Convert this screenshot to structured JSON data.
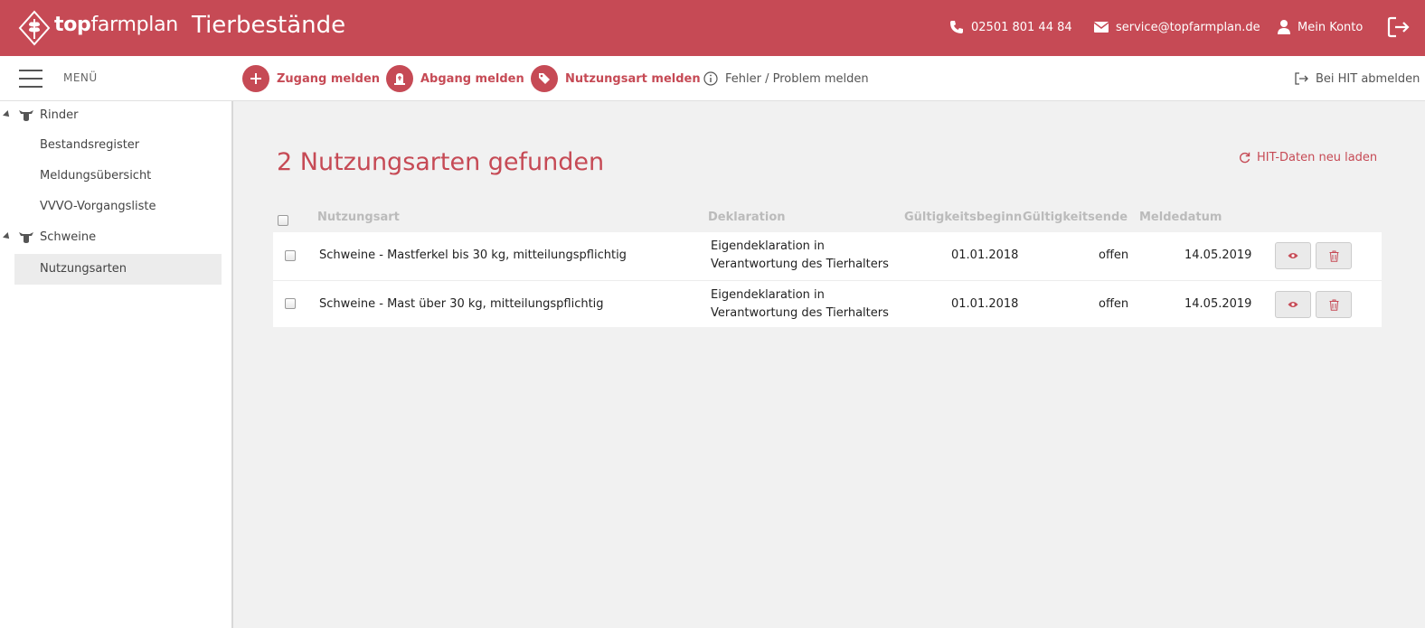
{
  "header": {
    "brand_bold": "top",
    "brand_rest": "farmplan",
    "title": "Tierbestände",
    "phone": "02501 801 44 84",
    "email": "service@topfarmplan.de",
    "account": "Mein Konto"
  },
  "toolbar": {
    "menu_label": "MENÜ",
    "actions": [
      {
        "label": "Zugang melden",
        "icon": "plus-icon"
      },
      {
        "label": "Abgang melden",
        "icon": "tombstone-icon"
      },
      {
        "label": "Nutzungsart melden",
        "icon": "tag-icon"
      },
      {
        "label": "Fehler / Problem melden",
        "icon": "info-icon"
      }
    ],
    "hit_logout": "Bei HIT abmelden"
  },
  "sidebar": {
    "groups": [
      {
        "label": "Rinder",
        "items": [
          "Bestandsregister",
          "Meldungsübersicht",
          "VVVO-Vorgangsliste"
        ]
      },
      {
        "label": "Schweine",
        "items": [
          "Nutzungsarten"
        ]
      }
    ],
    "active_item": "Nutzungsarten"
  },
  "main": {
    "title": "2 Nutzungsarten gefunden",
    "reload": "HIT-Daten neu laden",
    "columns": [
      "Nutzungsart",
      "Deklaration",
      "Gültigkeitsbeginn",
      "Gültigkeitsende",
      "Meldedatum"
    ],
    "rows": [
      {
        "nutzungsart": "Schweine - Mastferkel bis 30 kg, mitteilungspflichtig",
        "deklaration_1": "Eigendeklaration in",
        "deklaration_2": "Verantwortung des Tierhalters",
        "beginn": "01.01.2018",
        "ende": "offen",
        "meldedatum": "14.05.2019"
      },
      {
        "nutzungsart": "Schweine - Mast über 30 kg, mitteilungspflichtig",
        "deklaration_1": "Eigendeklaration in",
        "deklaration_2": "Verantwortung des Tierhalters",
        "beginn": "01.01.2018",
        "ende": "offen",
        "meldedatum": "14.05.2019"
      }
    ]
  },
  "colors": {
    "brand": "#c64a55",
    "background": "#f1f1f1"
  }
}
